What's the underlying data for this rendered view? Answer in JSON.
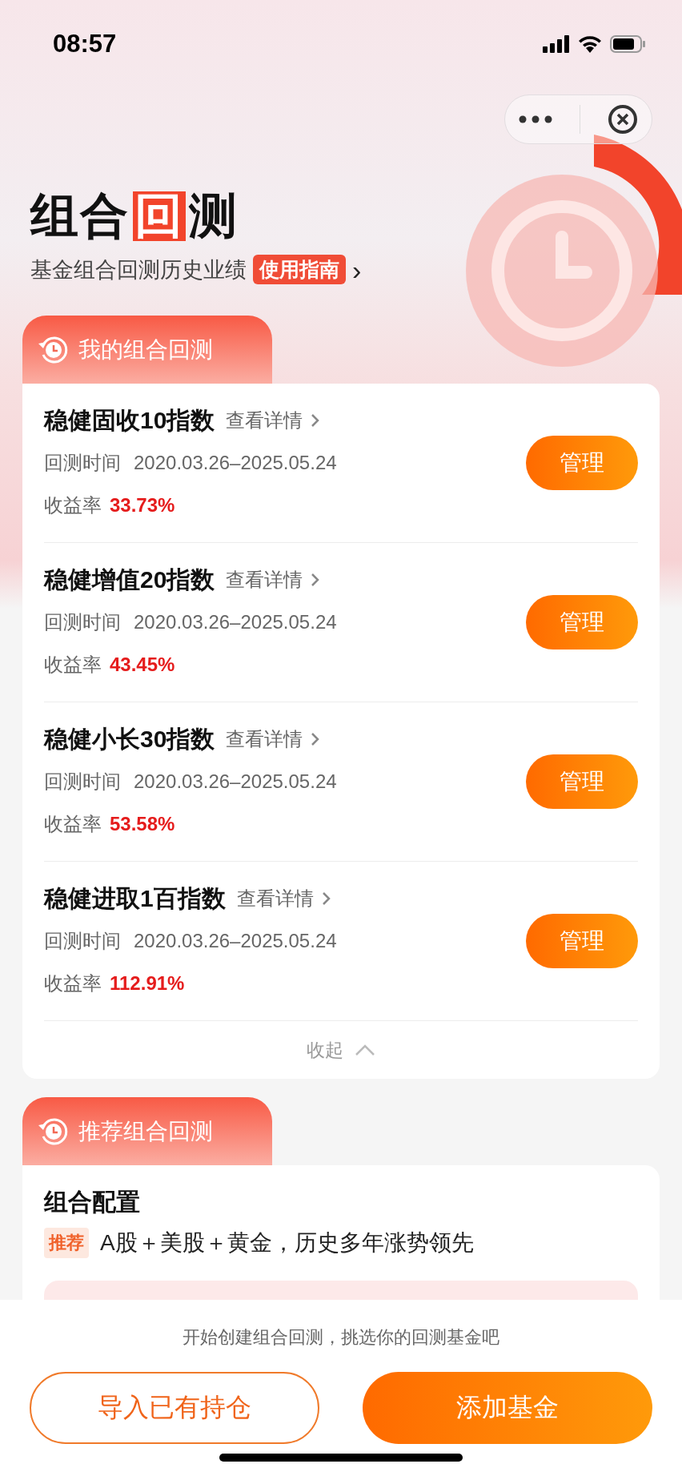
{
  "status_bar": {
    "time": "08:57"
  },
  "header": {
    "title_parts": [
      {
        "text": "组合",
        "boxed": false
      },
      {
        "text": "回",
        "boxed": true
      },
      {
        "text": "测",
        "boxed": false
      }
    ],
    "subtitle": "基金组合回测历史业绩",
    "guide_badge": "使用指南",
    "guide_arrow": "›"
  },
  "my_section": {
    "tab": "我的组合回测",
    "rows": [
      {
        "name": "稳健固收10指数",
        "details": "查看详情",
        "period_label": "回测时间",
        "period": "2020.03.26–2025.05.24",
        "return_label": "收益率",
        "return": "33.73%",
        "action": "管理"
      },
      {
        "name": "稳健增值20指数",
        "details": "查看详情",
        "period_label": "回测时间",
        "period": "2020.03.26–2025.05.24",
        "return_label": "收益率",
        "return": "43.45%",
        "action": "管理"
      },
      {
        "name": "稳健小长30指数",
        "details": "查看详情",
        "period_label": "回测时间",
        "period": "2020.03.26–2025.05.24",
        "return_label": "收益率",
        "return": "53.58%",
        "action": "管理"
      },
      {
        "name": "稳健进取1百指数",
        "details": "查看详情",
        "period_label": "回测时间",
        "period": "2020.03.26–2025.05.24",
        "return_label": "收益率",
        "return": "112.91%",
        "action": "管理"
      }
    ],
    "collapse": {
      "label": "收起",
      "expanded": true
    }
  },
  "recommend_section": {
    "tab": "推荐组合回测",
    "title": "组合配置",
    "tag": "推荐",
    "description": "A股＋美股＋黄金，历史多年涨势领先"
  },
  "bottom_bar": {
    "hint": "开始创建组合回测，挑选你的回测基金吧",
    "buttons": [
      {
        "label": "导入已有持仓",
        "kind": "outline"
      },
      {
        "label": "添加基金",
        "kind": "filled"
      }
    ]
  }
}
